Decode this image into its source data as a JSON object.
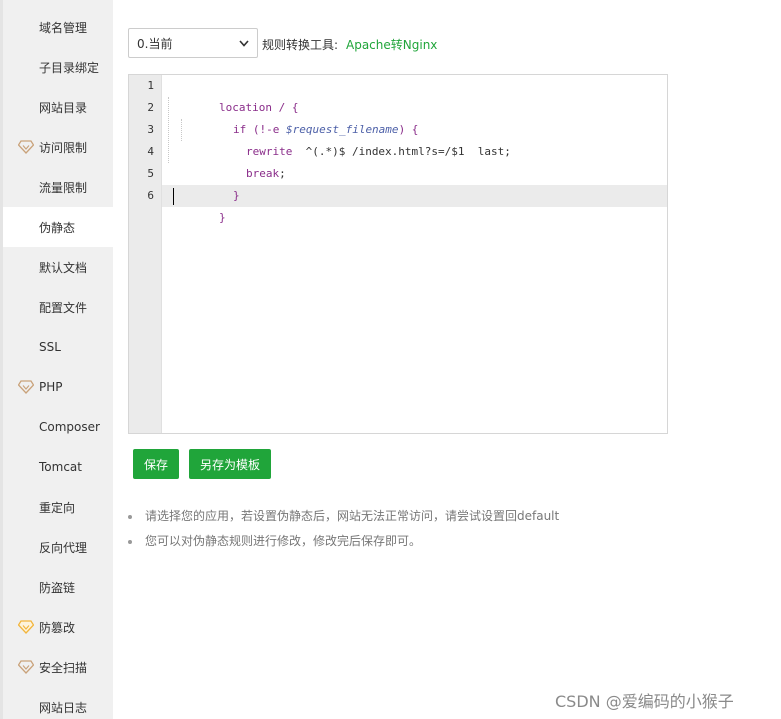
{
  "sidebar": {
    "items": [
      {
        "label": "域名管理",
        "icon": ""
      },
      {
        "label": "子目录绑定",
        "icon": ""
      },
      {
        "label": "网站目录",
        "icon": ""
      },
      {
        "label": "访问限制",
        "icon": "vip-diamond-icon"
      },
      {
        "label": "流量限制",
        "icon": ""
      },
      {
        "label": "伪静态",
        "icon": "",
        "active": true
      },
      {
        "label": "默认文档",
        "icon": ""
      },
      {
        "label": "配置文件",
        "icon": ""
      },
      {
        "label": "SSL",
        "icon": ""
      },
      {
        "label": "PHP",
        "icon": "vip-diamond-icon"
      },
      {
        "label": "Composer",
        "icon": ""
      },
      {
        "label": "Tomcat",
        "icon": ""
      },
      {
        "label": "重定向",
        "icon": ""
      },
      {
        "label": "反向代理",
        "icon": ""
      },
      {
        "label": "防盗链",
        "icon": ""
      },
      {
        "label": "防篡改",
        "icon": "pro-diamond-icon"
      },
      {
        "label": "安全扫描",
        "icon": "vip-diamond-icon"
      },
      {
        "label": "网站日志",
        "icon": ""
      }
    ]
  },
  "toolbar": {
    "select_value": "0.当前",
    "tool_label": "规则转换工具:",
    "tool_link": "Apache转Nginx"
  },
  "editor": {
    "line_numbers": [
      "1",
      "2",
      "3",
      "4",
      "5",
      "6"
    ],
    "lines": [
      {
        "t1": "location / {"
      },
      {
        "t1": "if (!-e ",
        "t2": "$request_filename",
        "t3": ") {"
      },
      {
        "t1": "rewrite",
        "t2": "  ^(.*)$ /index.html?s=/$1  last;"
      },
      {
        "t1": "break",
        "t2": ";"
      },
      {
        "t1": "}"
      },
      {
        "t1": "}"
      }
    ]
  },
  "buttons": {
    "save": "保存",
    "save_template": "另存为模板"
  },
  "tips": [
    "请选择您的应用，若设置伪静态后，网站无法正常访问，请尝试设置回default",
    "您可以对伪静态规则进行修改，修改完后保存即可。"
  ],
  "watermark": "CSDN @爱编码的小猴子",
  "colors": {
    "accent": "#20a53a",
    "sidebar_bg": "#f0f0f0",
    "vip_icon": "#c9a27a",
    "pro_icon": "#f2b53c"
  }
}
